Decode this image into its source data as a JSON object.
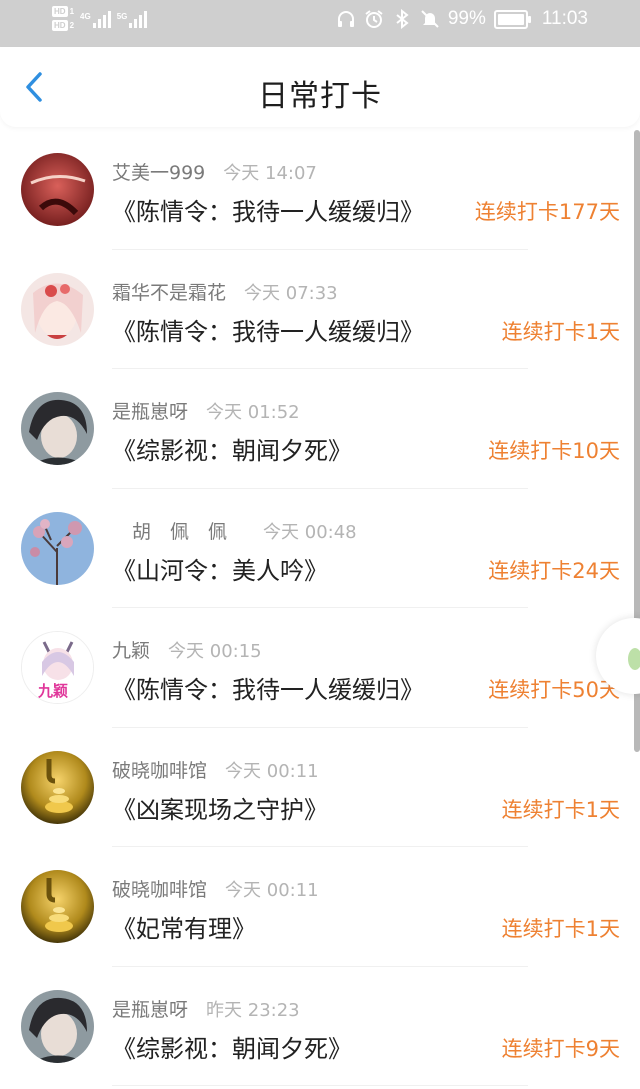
{
  "status_bar": {
    "hd1": "HD",
    "hd1_num": "1",
    "hd2": "HD",
    "hd2_num": "2",
    "net1": "4G",
    "net2": "5G",
    "battery_percent": "99%",
    "battery_level": 0.99,
    "time": "11:03",
    "icons": [
      "headphones-icon",
      "alarm-icon",
      "bluetooth-icon",
      "mute-icon",
      "battery-icon"
    ]
  },
  "header": {
    "title": "日常打卡",
    "back_icon": "chevron-left-icon",
    "accent": "#2f8fe0"
  },
  "colors": {
    "streak": "#ee8132",
    "username": "#7a7a7a",
    "time": "#b4b4b4",
    "book": "#222222"
  },
  "items": [
    {
      "username": "艾美一999",
      "time": "今天 14:07",
      "book": "《陈情令：我待一人缓缓归》",
      "streak": "连续打卡177天",
      "avatar": "avatar-red-art"
    },
    {
      "username": "霜华不是霜花",
      "time": "今天 07:33",
      "book": "《陈情令：我待一人缓缓归》",
      "streak": "连续打卡1天",
      "avatar": "avatar-anime-girl"
    },
    {
      "username": "是瓶崽呀",
      "time": "今天 01:52",
      "book": "《综影视：朝闻夕死》",
      "streak": "连续打卡10天",
      "avatar": "avatar-dark-hair"
    },
    {
      "username": "胡　佩　佩",
      "time": "今天 00:48",
      "book": "《山河令：美人吟》",
      "streak": "连续打卡24天",
      "avatar": "avatar-blossom-sky"
    },
    {
      "username": "九颖",
      "time": "今天 00:15",
      "book": "《陈情令：我待一人缓缓归》",
      "streak": "连续打卡50天",
      "avatar": "avatar-pink-girl"
    },
    {
      "username": "破晓咖啡馆",
      "time": "今天 00:11",
      "book": "《凶案现场之守护》",
      "streak": "连续打卡1天",
      "avatar": "avatar-gold-coins"
    },
    {
      "username": "破晓咖啡馆",
      "time": "今天 00:11",
      "book": "《妃常有理》",
      "streak": "连续打卡1天",
      "avatar": "avatar-gold-coins"
    },
    {
      "username": "是瓶崽呀",
      "time": "昨天 23:23",
      "book": "《综影视：朝闻夕死》",
      "streak": "连续打卡9天",
      "avatar": "avatar-dark-hair"
    }
  ]
}
